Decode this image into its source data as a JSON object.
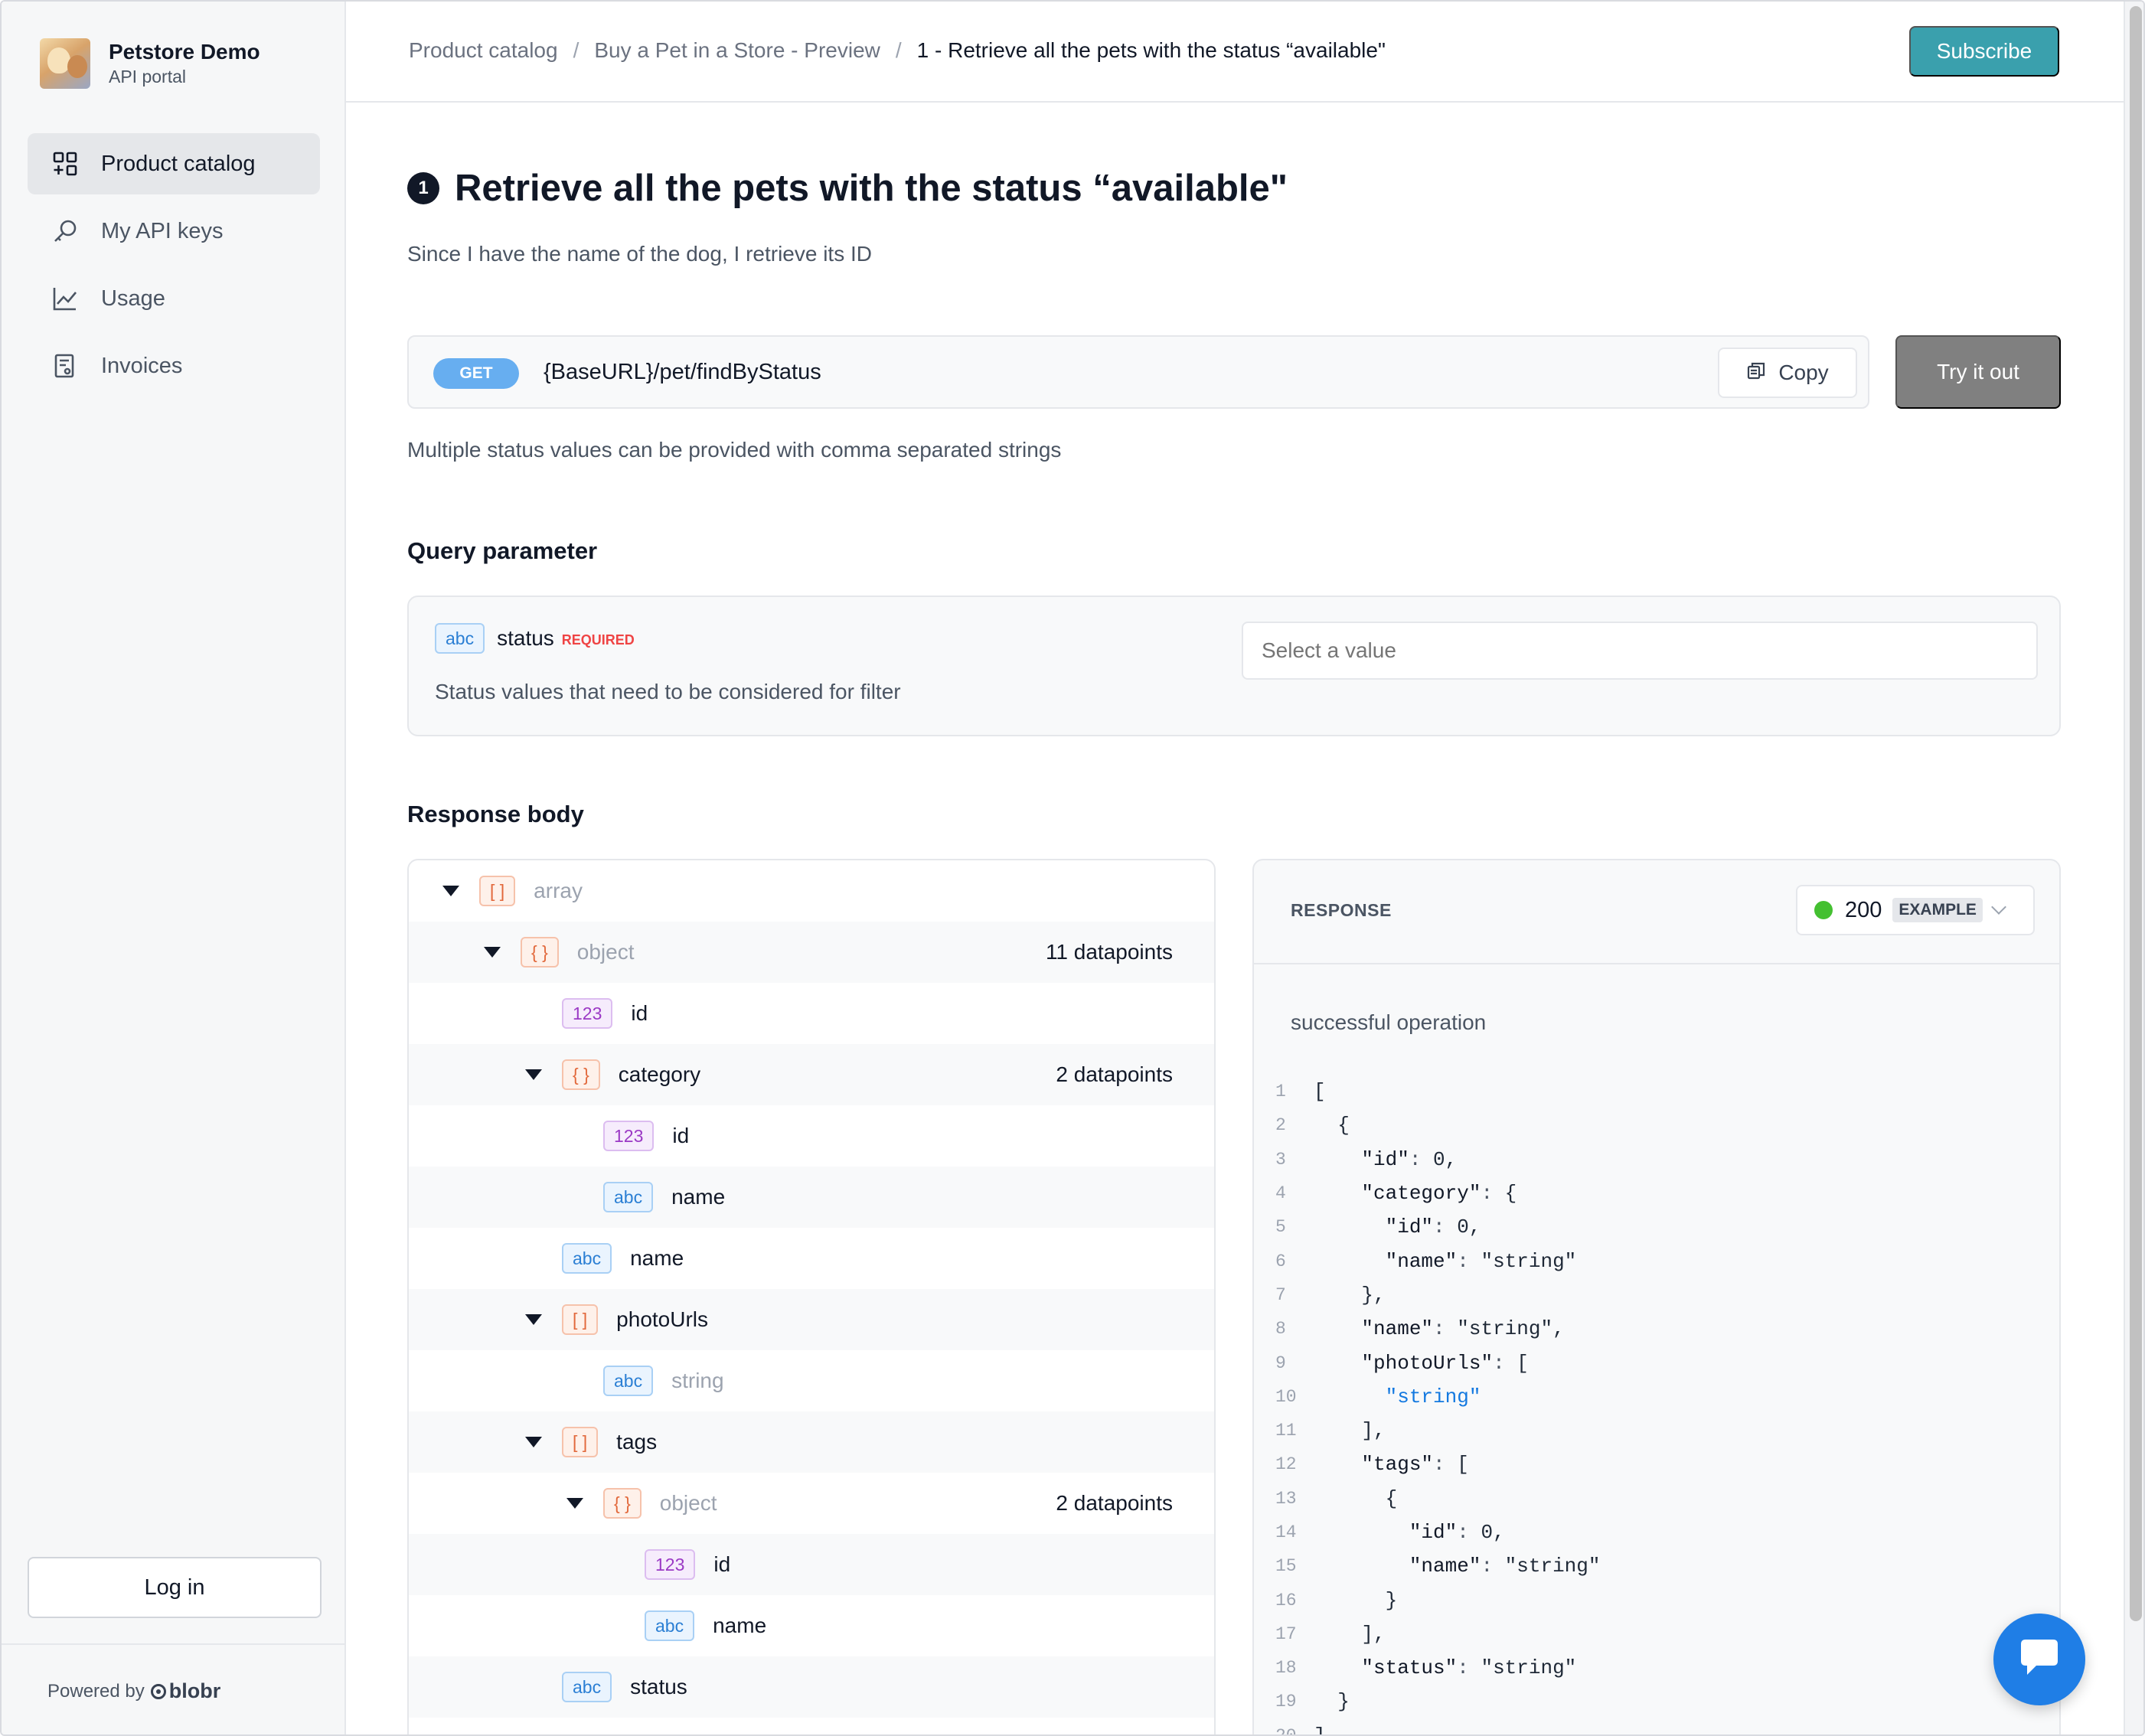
{
  "app": {
    "name": "Petstore Demo",
    "subtitle": "API portal"
  },
  "sidebar": {
    "items": [
      {
        "label": "Product catalog",
        "icon": "grid-plus-icon",
        "active": true
      },
      {
        "label": "My API keys",
        "icon": "key-icon",
        "active": false
      },
      {
        "label": "Usage",
        "icon": "chart-line-icon",
        "active": false
      },
      {
        "label": "Invoices",
        "icon": "invoice-icon",
        "active": false
      }
    ],
    "login_label": "Log in",
    "powered_by": "Powered by",
    "powered_brand": "blobr"
  },
  "header": {
    "breadcrumb": [
      "Product catalog",
      "Buy a Pet in a Store - Preview",
      "1 - Retrieve all the pets with the status “available\""
    ],
    "separator": "/",
    "subscribe_label": "Subscribe"
  },
  "main": {
    "step_number": "1",
    "title": "Retrieve all the pets with the status “available\"",
    "subtitle": "Since I have the name of the dog, I retrieve its ID",
    "endpoint": {
      "method": "GET",
      "url": "{BaseURL}/pet/findByStatus",
      "copy_label": "Copy",
      "try_label": "Try it out",
      "description": "Multiple status values can be provided with comma separated strings"
    },
    "query_section_title": "Query parameter",
    "query_param": {
      "type": "abc",
      "name": "status",
      "required_label": "REQUIRED",
      "description": "Status values that need to be considered for filter",
      "placeholder": "Select a value"
    },
    "response_section_title": "Response body",
    "tree": [
      {
        "type": "[ ]",
        "name": "array",
        "muted": true,
        "expanded": true,
        "datapoints": ""
      },
      {
        "type": "{ }",
        "name": "object",
        "muted": true,
        "expanded": true,
        "datapoints": "11 datapoints"
      },
      {
        "type": "123",
        "name": "id",
        "muted": false,
        "expanded": null,
        "datapoints": ""
      },
      {
        "type": "{ }",
        "name": "category",
        "muted": false,
        "expanded": true,
        "datapoints": "2 datapoints"
      },
      {
        "type": "123",
        "name": "id",
        "muted": false,
        "expanded": null,
        "datapoints": ""
      },
      {
        "type": "abc",
        "name": "name",
        "muted": false,
        "expanded": null,
        "datapoints": ""
      },
      {
        "type": "abc",
        "name": "name",
        "muted": false,
        "expanded": null,
        "datapoints": ""
      },
      {
        "type": "[ ]",
        "name": "photoUrls",
        "muted": false,
        "expanded": true,
        "datapoints": ""
      },
      {
        "type": "abc",
        "name": "string",
        "muted": true,
        "expanded": null,
        "datapoints": ""
      },
      {
        "type": "[ ]",
        "name": "tags",
        "muted": false,
        "expanded": true,
        "datapoints": ""
      },
      {
        "type": "{ }",
        "name": "object",
        "muted": true,
        "expanded": true,
        "datapoints": "2 datapoints"
      },
      {
        "type": "123",
        "name": "id",
        "muted": false,
        "expanded": null,
        "datapoints": ""
      },
      {
        "type": "abc",
        "name": "name",
        "muted": false,
        "expanded": null,
        "datapoints": ""
      },
      {
        "type": "abc",
        "name": "status",
        "muted": false,
        "expanded": null,
        "datapoints": ""
      }
    ],
    "response": {
      "label": "RESPONSE",
      "status_code": "200",
      "example_label": "EXAMPLE",
      "description": "successful operation",
      "code_lines": [
        "[",
        "  {",
        "    \"id\": 0,",
        "    \"category\": {",
        "      \"id\": 0,",
        "      \"name\": \"string\"",
        "    },",
        "    \"name\": \"string\",",
        "    \"photoUrls\": [",
        "      \"string\"",
        "    ],",
        "    \"tags\": [",
        "      {",
        "        \"id\": 0,",
        "        \"name\": \"string\"",
        "      }",
        "    ],",
        "    \"status\": \"string\"",
        "  }",
        "]"
      ]
    }
  },
  "colors": {
    "accent": "#3aa0ad",
    "get_badge": "#67aef0",
    "status_ok": "#44c031",
    "chat": "#1f7ee6"
  }
}
